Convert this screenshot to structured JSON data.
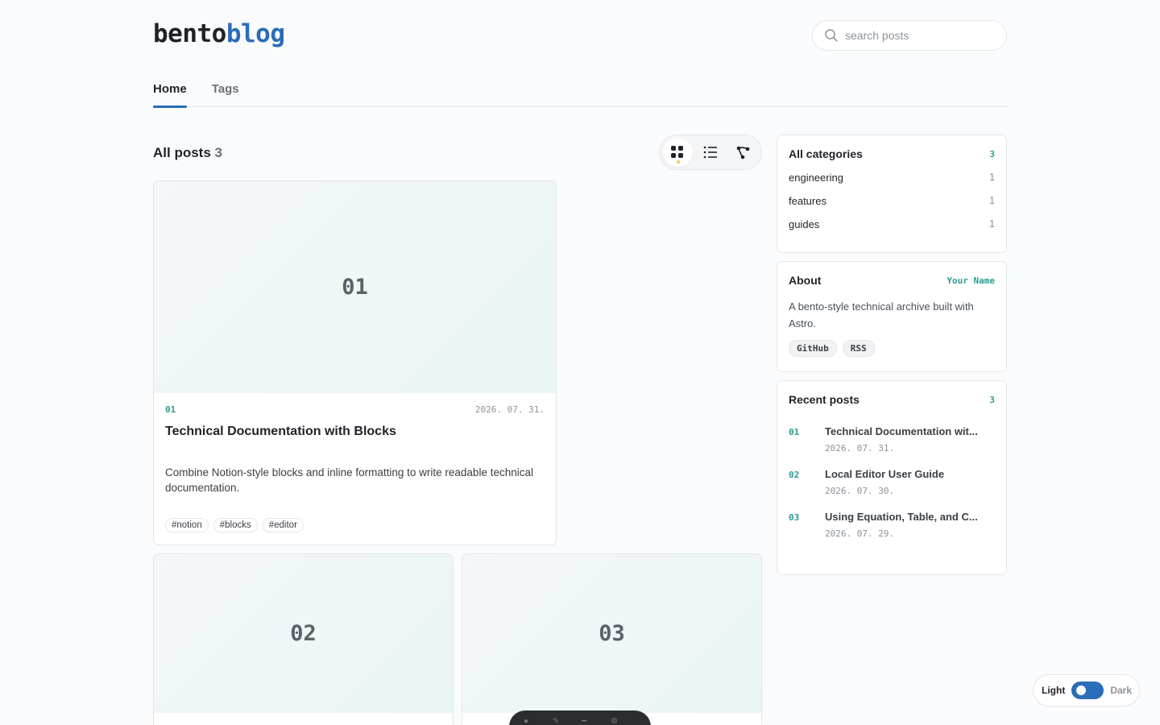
{
  "header": {
    "logo_part1": "bento",
    "logo_part2": "blog",
    "search_placeholder": "search posts"
  },
  "tabs": [
    {
      "label": "Home",
      "active": true
    },
    {
      "label": "Tags",
      "active": false
    }
  ],
  "posts": {
    "heading": "All posts",
    "count": "3",
    "items": [
      {
        "thumb": "01",
        "num": "01",
        "date": "2026. 07. 31.",
        "title": "Technical Documentation with Blocks",
        "desc": "Combine Notion-style blocks and inline formatting to write readable technical documentation.",
        "tags": [
          "#notion",
          "#blocks",
          "#editor"
        ]
      },
      {
        "thumb": "02"
      },
      {
        "thumb": "03"
      }
    ]
  },
  "view_modes": [
    {
      "icon": "grid-icon",
      "active": true
    },
    {
      "icon": "list-icon",
      "active": false
    },
    {
      "icon": "graph-icon",
      "active": false
    }
  ],
  "sidebar": {
    "categories": {
      "title": "All categories",
      "count": "3",
      "items": [
        {
          "name": "engineering",
          "count": "1"
        },
        {
          "name": "features",
          "count": "1"
        },
        {
          "name": "guides",
          "count": "1"
        }
      ]
    },
    "about": {
      "title": "About",
      "author": "Your Name",
      "text": "A bento-style technical archive built with Astro.",
      "links": [
        "GitHub",
        "RSS"
      ]
    },
    "recent": {
      "title": "Recent posts",
      "count": "3",
      "items": [
        {
          "num": "01",
          "title": "Technical Documentation wit...",
          "date": "2026. 07. 31."
        },
        {
          "num": "02",
          "title": "Local Editor User Guide",
          "date": "2026. 07. 30."
        },
        {
          "num": "03",
          "title": "Using Equation, Table, and C...",
          "date": "2026. 07. 29."
        }
      ]
    }
  },
  "theme": {
    "light_label": "Light",
    "dark_label": "Dark",
    "dark_enabled": false
  },
  "colors": {
    "accent": "#2a6db8",
    "teal": "#2a9d8f"
  }
}
